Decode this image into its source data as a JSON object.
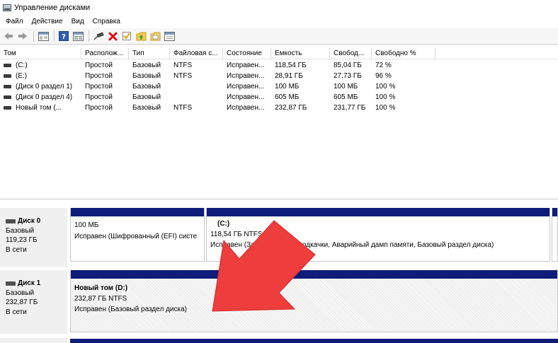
{
  "window": {
    "title": "Управление дисками",
    "icon": "disk-management-icon"
  },
  "menu": [
    "Файл",
    "Действие",
    "Вид",
    "Справка"
  ],
  "toolbar": [
    {
      "name": "back-icon"
    },
    {
      "name": "forward-icon"
    },
    {
      "sep": true
    },
    {
      "name": "properties-panel-icon"
    },
    {
      "sep": true
    },
    {
      "name": "help-icon"
    },
    {
      "name": "list-view-icon"
    },
    {
      "sep": true
    },
    {
      "name": "connect-icon"
    },
    {
      "name": "delete-icon"
    },
    {
      "name": "check-icon"
    },
    {
      "name": "folder-up-icon"
    },
    {
      "name": "folder-search-icon"
    },
    {
      "name": "settings-panel-icon"
    }
  ],
  "volume_list": {
    "columns": [
      "Том",
      "Располож...",
      "Тип",
      "Файловая с...",
      "Состояние",
      "Емкость",
      "Свобод...",
      "Свободно %"
    ],
    "rows": [
      [
        "(C:)",
        "Простой",
        "Базовый",
        "NTFS",
        "Исправен...",
        "118,54 ГБ",
        "85,04 ГБ",
        "72 %"
      ],
      [
        "(E:)",
        "Простой",
        "Базовый",
        "NTFS",
        "Исправен...",
        "28,91 ГБ",
        "27,73 ГБ",
        "96 %"
      ],
      [
        "(Диск 0 раздел 1)",
        "Простой",
        "Базовый",
        "",
        "Исправен...",
        "100 МБ",
        "100 МБ",
        "100 %"
      ],
      [
        "(Диск 0 раздел 4)",
        "Простой",
        "Базовый",
        "",
        "Исправен...",
        "605 МБ",
        "605 МБ",
        "100 %"
      ],
      [
        "Новый том (...",
        "Простой",
        "Базовый",
        "NTFS",
        "Исправен...",
        "232,87 ГБ",
        "231,77 ГБ",
        "100 %"
      ]
    ]
  },
  "disks": [
    {
      "name": "Диск 0",
      "type": "Базовый",
      "size": "119,23 ГБ",
      "status": "В сети",
      "partitions": [
        {
          "title": "",
          "line1": "100 МБ",
          "line2": "Исправен (Шифрованный (EFI) систе"
        },
        {
          "title": "(C:)",
          "line1": "118,54 ГБ NTFS",
          "line2": "Исправен (Загрузка, Файл подкачки, Аварийный дамп памяти, Базовый раздел диска)"
        }
      ]
    },
    {
      "name": "Диск 1",
      "type": "Базовый",
      "size": "232,87 ГБ",
      "status": "В сети",
      "partitions": [
        {
          "title": "Новый том  (D:)",
          "line1": "232,87 ГБ NTFS",
          "line2": "Исправен (Базовый раздел диска)"
        }
      ]
    }
  ],
  "colors": {
    "partition_cap": "#0c1c78",
    "arrow": "#ee3d3d"
  },
  "overlay": {
    "icon": "red-arrow-icon"
  }
}
